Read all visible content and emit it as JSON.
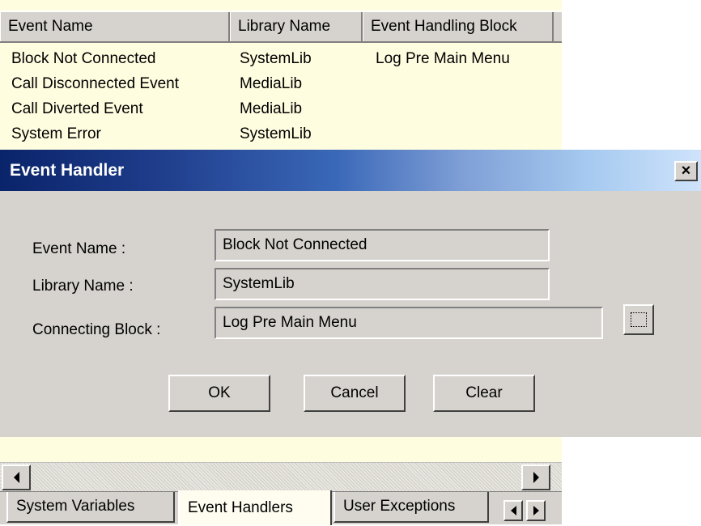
{
  "list": {
    "columns": [
      "Event Name",
      "Library Name",
      "Event Handling Block"
    ],
    "rows": [
      {
        "event": "Block Not Connected",
        "library": "SystemLib",
        "block": "Log Pre Main Menu"
      },
      {
        "event": "Call Disconnected Event",
        "library": "MediaLib",
        "block": ""
      },
      {
        "event": "Call Diverted Event",
        "library": "MediaLib",
        "block": ""
      },
      {
        "event": "System Error",
        "library": "SystemLib",
        "block": ""
      }
    ]
  },
  "dialog": {
    "title": "Event Handler",
    "close_glyph": "×",
    "event_name_label": "Event Name :",
    "event_name_value": "Block Not Connected",
    "library_name_label": "Library Name :",
    "library_name_value": "SystemLib",
    "connecting_block_label": "Connecting Block :",
    "connecting_block_value": "Log Pre Main Menu",
    "ok_label": "OK",
    "cancel_label": "Cancel",
    "clear_label": "Clear"
  },
  "tabs": [
    {
      "label": "System Variables",
      "active": false
    },
    {
      "label": "Event Handlers",
      "active": true
    },
    {
      "label": "User Exceptions",
      "active": false
    }
  ],
  "colors": {
    "list_background": "#fffde0",
    "dialog_background": "#d6d3ce",
    "titlebar_start": "#0a246a",
    "titlebar_end": "#cfe3fb"
  },
  "icons": [
    "close-icon",
    "browse-icon",
    "scroll-left-icon",
    "scroll-right-icon",
    "tab-scroll-left-icon",
    "tab-scroll-right-icon"
  ]
}
